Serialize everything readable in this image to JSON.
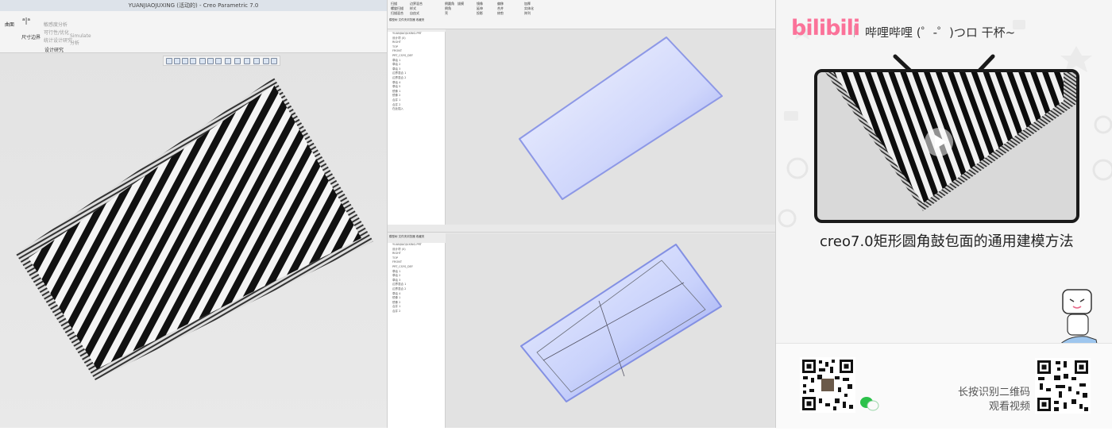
{
  "left_window": {
    "title": "YUANJIAOJUXING (活动的) - Creo Parametric 7.0",
    "ribbon": {
      "surface_group": "曲面",
      "dimension_btn": "尺寸边界",
      "sensitivity_btn": "敏感度分析",
      "feasibility_btn": "可行性/优化",
      "stat_btn": "统计设计研究",
      "simulate_btn": "Simulate 分析",
      "group_label": "设计研究"
    }
  },
  "mid_top": {
    "tree_tab_1": "模型树",
    "tree_tab_2": "文件夹浏览器",
    "tree_tab_3": "收藏夹",
    "tree_items": [
      "YUANJIAOJUXING.PRT",
      "设计项 (0)",
      "RIGHT",
      "TOP",
      "FRONT",
      "PRT_CSYS_DEF",
      "草绘 1",
      "草绘 2",
      "草绘 3",
      "边界混合 1",
      "边界混合 2",
      "草绘 4",
      "草绘 5",
      "镜像 1",
      "镜像 2",
      "合并 1",
      "合并 2",
      "在此插入"
    ],
    "ribbon_labels": [
      "扫描",
      "螺旋扫描",
      "扫描混合",
      "边界混合",
      "样式",
      "自由式",
      "倒圆角",
      "倒角",
      "壳",
      "拔模",
      "镜像",
      "延伸",
      "投影",
      "偏移",
      "合并",
      "修剪",
      "加厚",
      "实体化",
      "阵列"
    ]
  },
  "mid_bottom": {
    "tree_tab_1": "模型树",
    "tree_tab_2": "文件夹浏览器",
    "tree_tab_3": "收藏夹",
    "tree_items": [
      "YUANJIAOJUXING.PRT",
      "设计项 (0)",
      "RIGHT",
      "TOP",
      "FRONT",
      "PRT_CSYS_DEF",
      "草绘 1",
      "草绘 2",
      "草绘 3",
      "边界混合 1",
      "边界混合 2",
      "草绘 4",
      "镜像 1",
      "镜像 2",
      "合并 1",
      "合并 2"
    ]
  },
  "promo_card": {
    "logo_text": "bilibili",
    "slogan": "哔哩哔哩 (゜-゜)つロ 干杯~",
    "video_title": "creo7.0矩形圆角鼓包面的通用建模方法",
    "hint_line1": "长按识别二维码",
    "hint_line2": "观看视频",
    "brand_color": "#fb7299"
  }
}
